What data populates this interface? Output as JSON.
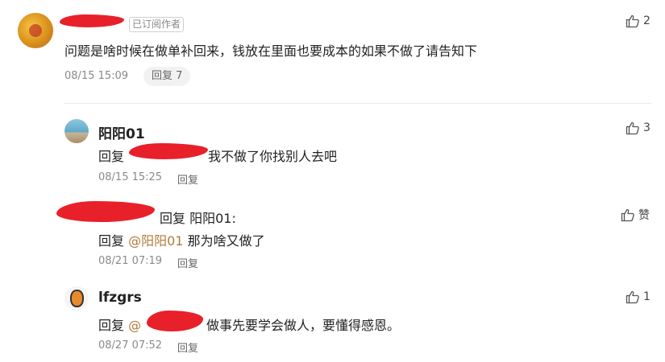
{
  "comment": {
    "badge": "已订阅作者",
    "text": "问题是啥时候在做单补回来，钱放在里面也要成本的如果不做了请告知下",
    "time": "08/15 15:09",
    "reply_btn": "回复 7",
    "likes": "2"
  },
  "replies": [
    {
      "name": "阳阳01",
      "prefix": "回复",
      "text_after": "我不做了你找别人去吧",
      "time": "08/15 15:25",
      "reply_label": "回复",
      "likes": "3"
    },
    {
      "header_reply": "回复 阳阳01:",
      "prefix": "回复",
      "mention": "@阳阳01",
      "text_after": "那为啥又做了",
      "time": "08/21 07:19",
      "reply_label": "回复",
      "likes": "赞"
    },
    {
      "name": "lfzgrs",
      "prefix": "回复",
      "mention_start": "@",
      "text_after": "做事先要学会做人，要懂得感恩。",
      "time": "08/27 07:52",
      "reply_label": "回复",
      "likes": "1"
    }
  ],
  "icons": {
    "like": "thumbs-up-icon"
  },
  "colors": {
    "mention": "#b07a3d",
    "redaction": "#e8202a"
  }
}
